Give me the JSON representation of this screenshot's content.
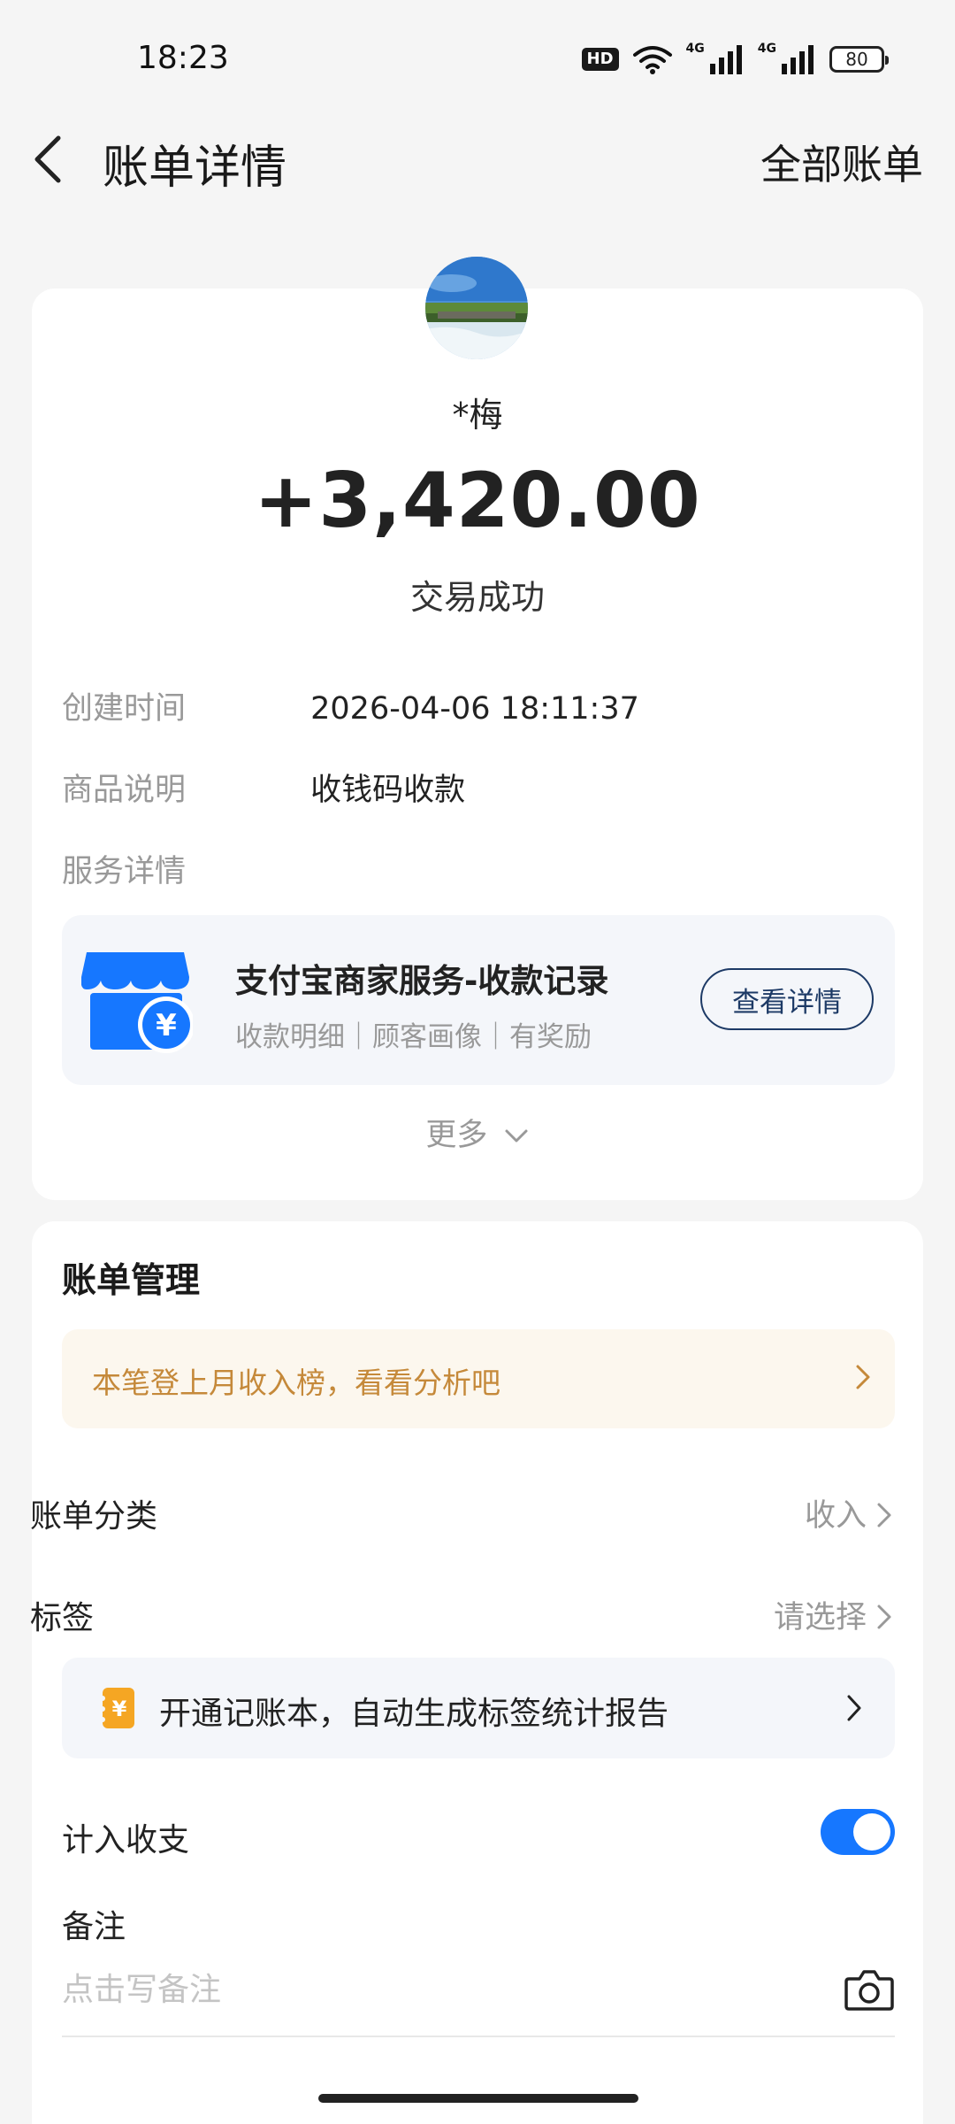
{
  "status_bar": {
    "time": "18:23",
    "hd_badge": "HD",
    "net1": "4G",
    "net2": "4G",
    "battery": "80",
    "icons": [
      "hd-icon",
      "wifi-icon",
      "signal-icon",
      "signal-icon",
      "battery-icon"
    ]
  },
  "nav": {
    "title": "账单详情",
    "right_link": "全部账单",
    "back_icon": "chevron-left-icon"
  },
  "bill": {
    "payer_name": "*梅",
    "amount": "+3,420.00",
    "status": "交易成功",
    "created_label": "创建时间",
    "created_value": "2026-04-06 18:11:37",
    "goods_label": "商品说明",
    "goods_value": "收钱码收款",
    "service_label": "服务详情",
    "merchant_title": "支付宝商家服务-收款记录",
    "merchant_sub": "收款明细｜顾客画像｜有奖励",
    "detail_button": "查看详情",
    "more": "更多"
  },
  "manage": {
    "title": "账单管理",
    "tip": "本笔登上月收入榜，看看分析吧",
    "category_label": "账单分类",
    "category_value": "收入",
    "tag_label": "标签",
    "tag_value": "请选择",
    "ledger_text": "开通记账本，自动生成标签统计报告",
    "count_label": "计入收支",
    "count_enabled": true,
    "remark_label": "备注",
    "remark_placeholder": "点击写备注",
    "remark_value": ""
  },
  "colors": {
    "accent_blue": "#1677ff",
    "button_border": "#1d3a66",
    "tip_text": "#c5893a",
    "tip_bg": "#fcf7ee",
    "merchant_icon": "#1677ff",
    "ledger_icon": "#f5a623"
  }
}
